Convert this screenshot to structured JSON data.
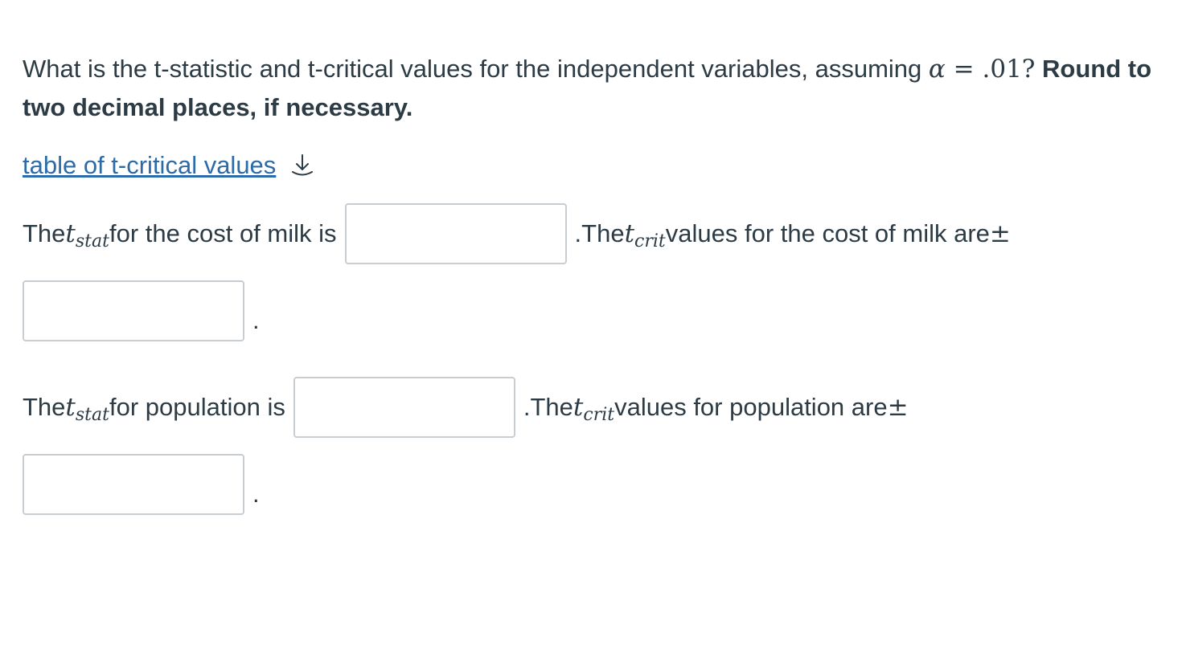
{
  "question": {
    "text": "What is the t-statistic and t-critical values for the independent variables, assuming ",
    "alpha_symbol": "α",
    "equals": " = ",
    "alpha_value": ".01?",
    "bold_text": " Round to two decimal places, if necessary."
  },
  "link": {
    "label": "table of t-critical values",
    "icon": "download-arrow-icon"
  },
  "milk": {
    "prefix": "The ",
    "t": "t",
    "stat_sub": "stat",
    "after_stat": " for the cost of milk is",
    "stat_input_value": "",
    "period": ". ",
    "crit_prefix": "The ",
    "crit_sub": "crit",
    "after_crit": " values for the cost of milk are ",
    "pm": "±",
    "crit_input_value": "",
    "end_period": "."
  },
  "population": {
    "prefix": "The ",
    "t": "t",
    "stat_sub": "stat",
    "after_stat": " for population is",
    "stat_input_value": "",
    "period": ". ",
    "crit_prefix": "The ",
    "crit_sub": "crit",
    "after_crit": " values for population are ",
    "pm": "±",
    "crit_input_value": "",
    "end_period": "."
  },
  "colors": {
    "link": "#2b6ba9",
    "text": "#2d3b45",
    "input_border": "#c7cdd1"
  }
}
